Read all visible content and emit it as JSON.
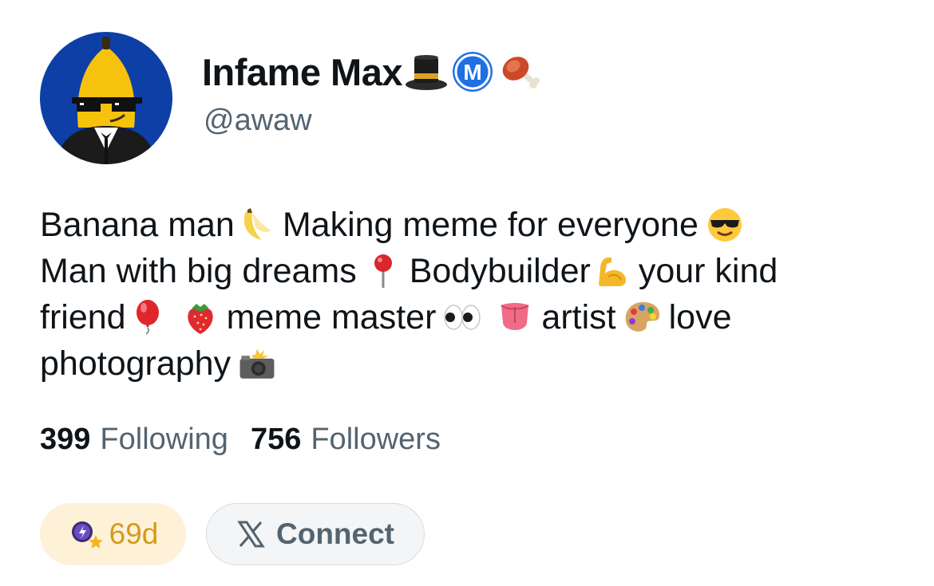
{
  "profile": {
    "display_name": "Infame Max",
    "name_icons": [
      "top-hat-icon",
      "m-badge-icon",
      "meat-on-bone-icon"
    ],
    "handle": "@awaw",
    "avatar": "banana-with-sunglasses-avatar"
  },
  "bio": {
    "lines": [
      [
        {
          "type": "text",
          "value": "Banana man"
        },
        {
          "type": "emoji",
          "name": "banana-icon"
        },
        {
          "type": "text",
          "value": "Making meme for everyone"
        },
        {
          "type": "emoji",
          "name": "sunglasses-face-icon"
        }
      ],
      [
        {
          "type": "text",
          "value": "Man with big dreams"
        },
        {
          "type": "emoji",
          "name": "round-pushpin-icon"
        },
        {
          "type": "text",
          "value": "Bodybuilder"
        },
        {
          "type": "emoji",
          "name": "flexed-biceps-icon"
        },
        {
          "type": "text",
          "value": "your kind"
        }
      ],
      [
        {
          "type": "text",
          "value": "friend"
        },
        {
          "type": "emoji",
          "name": "balloon-icon"
        },
        {
          "type": "emoji",
          "name": "strawberry-icon"
        },
        {
          "type": "text",
          "value": "meme master"
        },
        {
          "type": "emoji",
          "name": "eyes-icon"
        },
        {
          "type": "emoji",
          "name": "tongue-icon"
        },
        {
          "type": "text",
          "value": "artist"
        },
        {
          "type": "emoji",
          "name": "artist-palette-icon"
        },
        {
          "type": "text",
          "value": "love"
        }
      ],
      [
        {
          "type": "text",
          "value": "photography"
        },
        {
          "type": "emoji",
          "name": "camera-with-flash-icon"
        }
      ]
    ]
  },
  "stats": {
    "following_count": "399",
    "following_label": "Following",
    "followers_count": "756",
    "followers_label": "Followers"
  },
  "streak": {
    "icon": "streak-badge-icon",
    "label": "69d"
  },
  "connect": {
    "icon": "x-logo-icon",
    "label": "Connect"
  },
  "colors": {
    "text_primary": "#0f1419",
    "text_secondary": "#536471",
    "streak_bg": "#fdf1d8",
    "streak_text": "#d69a19",
    "connect_bg": "#f4f5f6",
    "avatar_bg": "#0d3fa6"
  }
}
